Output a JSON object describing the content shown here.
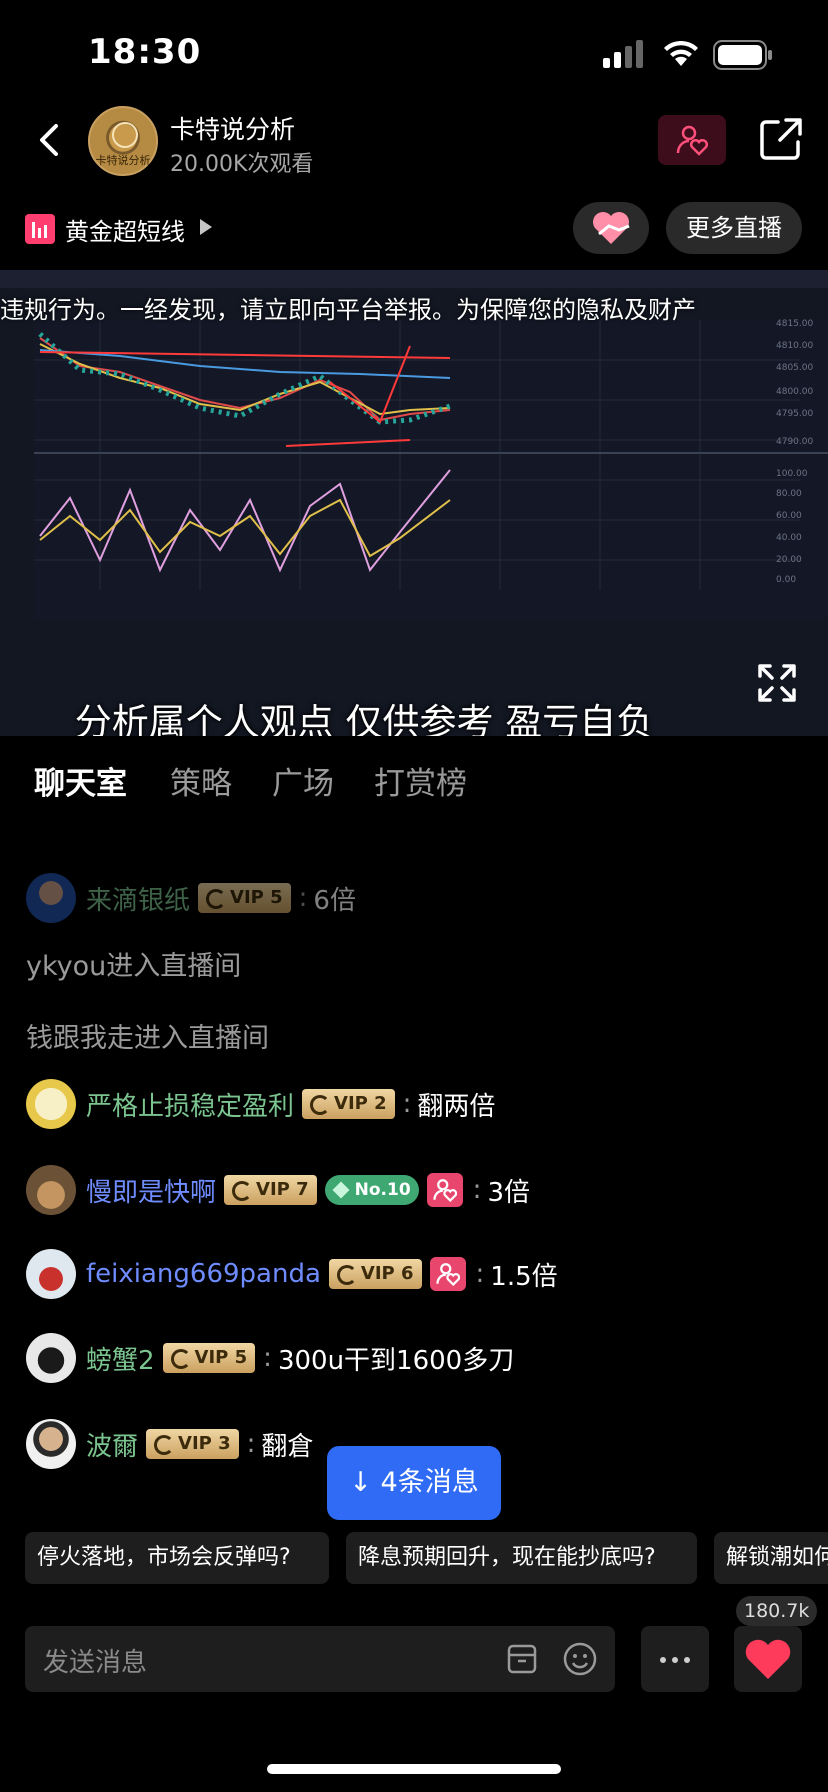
{
  "status": {
    "time": "18:30"
  },
  "header": {
    "host_name": "卡特说分析",
    "views": "20.00K次观看",
    "avatar_text": "卡特说分析"
  },
  "channel": {
    "name": "黄金超短线",
    "more_live": "更多直播"
  },
  "video": {
    "marquee": "违规行为。一经发现，请立即向平台举报。为保障您的隐私及财产",
    "subtitle": "分析属个人观点 仅供参考 盈亏自负"
  },
  "tabs": [
    {
      "label": "聊天室",
      "active": true
    },
    {
      "label": "策略",
      "active": false
    },
    {
      "label": "广场",
      "active": false
    },
    {
      "label": "打赏榜",
      "active": false
    }
  ],
  "chat": {
    "messages": [
      {
        "user": "来滴银纸",
        "vip": "VIP 5",
        "text": "6倍"
      },
      {
        "system": "ykyou进入直播间"
      },
      {
        "system": "钱跟我走进入直播间"
      },
      {
        "user": "严格止损稳定盈利",
        "vip": "VIP 2",
        "text": "翻两倍"
      },
      {
        "user": "慢即是快啊",
        "vip": "VIP 7",
        "rank_badge": "No.10",
        "text": "3倍"
      },
      {
        "user": "feixiang669panda",
        "vip": "VIP 6",
        "text": "1.5倍"
      },
      {
        "user": "螃蟹2",
        "vip": "VIP 5",
        "text": "300u干到1600多刀"
      },
      {
        "user": "波爾",
        "vip": "VIP 3",
        "text": "翻倉"
      }
    ],
    "new_messages": "4条消息"
  },
  "quick_questions": [
    "停火落地，市场会反弹吗?",
    "降息预期回升，现在能抄底吗?",
    "解锁潮如何"
  ],
  "input": {
    "placeholder": "发送消息",
    "like_count": "180.7k"
  },
  "colors": {
    "accent_blue": "#2f6bf5",
    "vip_gold": "#caa05f",
    "username_green": "#7bc48f",
    "username_blue": "#6f8cff",
    "fan_pink": "#e8466d"
  }
}
